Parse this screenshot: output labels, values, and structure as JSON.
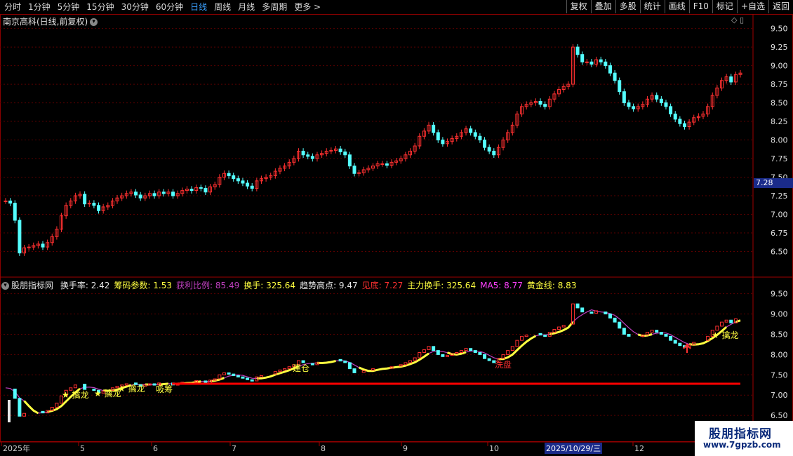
{
  "toolbar": {
    "periods": [
      "分时",
      "1分钟",
      "5分钟",
      "15分钟",
      "30分钟",
      "60分钟",
      "日线",
      "周线",
      "月线",
      "多周期",
      "更多 >"
    ],
    "active_period": "日线",
    "right_buttons": [
      "复权",
      "叠加",
      "多股",
      "统计",
      "画线",
      "F10",
      "标记",
      "+自选",
      "返回"
    ]
  },
  "chart_title": "南京高科(日线,前复权)",
  "price_axis": [
    "9.50",
    "9.25",
    "9.00",
    "8.75",
    "8.50",
    "8.25",
    "8.00",
    "7.75",
    "7.50",
    "7.25",
    "7.00",
    "6.75",
    "6.50"
  ],
  "current_price_tag": "7.28",
  "indicator_line": {
    "name": "股朋指标网",
    "items": [
      {
        "label": "换手率: 2.42",
        "color": "#e8e8e8"
      },
      {
        "label": "筹码参数: 1.53",
        "color": "#ffff40"
      },
      {
        "label": "获利比例: 85.49",
        "color": "#c040c0"
      },
      {
        "label": "换手: 325.64",
        "color": "#ffff40"
      },
      {
        "label": "趋势高点: 9.47",
        "color": "#e8e8e8"
      },
      {
        "label": "见底: 7.27",
        "color": "#ff3030"
      },
      {
        "label": "主力换手: 325.64",
        "color": "#ffff40"
      },
      {
        "label": "MA5: 8.77",
        "color": "#ff40ff"
      },
      {
        "label": "黄金线: 8.83",
        "color": "#ffff40"
      }
    ]
  },
  "indicator_axis": [
    "9.50",
    "9.00",
    "8.50",
    "8.00",
    "7.50",
    "7.00",
    "6.50"
  ],
  "annotations": [
    {
      "text": "★ 擒龙",
      "color": "#ffff40"
    },
    {
      "text": "★ 擒龙",
      "color": "#ffff40"
    },
    {
      "text": "★ 擒龙",
      "color": "#ffff40"
    },
    {
      "text": "吸筹",
      "color": "#ffff40"
    },
    {
      "text": "建仓",
      "color": "#ffff40"
    },
    {
      "text": "洗盘",
      "color": "#ff3030"
    },
    {
      "text": "★ 擒龙",
      "color": "#ffff40"
    }
  ],
  "date_axis": [
    "2025年",
    "5",
    "6",
    "7",
    "8",
    "9",
    "10",
    "12"
  ],
  "date_highlight": "2025/10/29/三",
  "watermark": {
    "line1": "股朋指标网",
    "line2": "www.7gpzb.com"
  },
  "colors": {
    "up": "#ff3030",
    "down": "#54ffff",
    "ma": "#c040c0",
    "gold": "#ffff40",
    "red_line": "#ff0000",
    "grid": "#5a0000"
  },
  "chart_data": {
    "type": "candlestick",
    "title": "南京高科(日线,前复权)",
    "y_range": [
      6.25,
      9.6
    ],
    "closes": [
      7.18,
      7.15,
      6.92,
      6.48,
      6.55,
      6.56,
      6.58,
      6.6,
      6.56,
      6.62,
      6.7,
      6.8,
      6.98,
      7.12,
      7.18,
      7.25,
      7.27,
      7.14,
      7.15,
      7.12,
      7.05,
      7.1,
      7.12,
      7.18,
      7.22,
      7.25,
      7.28,
      7.3,
      7.26,
      7.22,
      7.25,
      7.28,
      7.25,
      7.3,
      7.28,
      7.3,
      7.25,
      7.28,
      7.32,
      7.34,
      7.32,
      7.36,
      7.35,
      7.3,
      7.37,
      7.4,
      7.5,
      7.55,
      7.52,
      7.48,
      7.45,
      7.42,
      7.38,
      7.35,
      7.45,
      7.48,
      7.5,
      7.52,
      7.58,
      7.62,
      7.65,
      7.7,
      7.75,
      7.85,
      7.8,
      7.78,
      7.75,
      7.8,
      7.82,
      7.85,
      7.86,
      7.88,
      7.84,
      7.8,
      7.65,
      7.55,
      7.56,
      7.6,
      7.62,
      7.65,
      7.68,
      7.68,
      7.66,
      7.7,
      7.72,
      7.75,
      7.8,
      7.85,
      7.92,
      8.05,
      8.12,
      8.2,
      8.1,
      8.0,
      7.95,
      7.98,
      8.02,
      8.05,
      8.1,
      8.15,
      8.1,
      8.05,
      8.0,
      7.9,
      7.85,
      7.8,
      7.9,
      8.0,
      8.1,
      8.2,
      8.35,
      8.45,
      8.48,
      8.5,
      8.52,
      8.48,
      8.45,
      8.55,
      8.62,
      8.68,
      8.72,
      8.75,
      9.25,
      9.15,
      9.05,
      9.05,
      9.02,
      9.08,
      9.05,
      9.0,
      8.9,
      8.8,
      8.65,
      8.5,
      8.45,
      8.42,
      8.45,
      8.48,
      8.55,
      8.6,
      8.55,
      8.5,
      8.45,
      8.35,
      8.28,
      8.22,
      8.18,
      8.24,
      8.3,
      8.32,
      8.35,
      8.45,
      8.6,
      8.7,
      8.8,
      8.85,
      8.78,
      8.88,
      8.9
    ]
  }
}
